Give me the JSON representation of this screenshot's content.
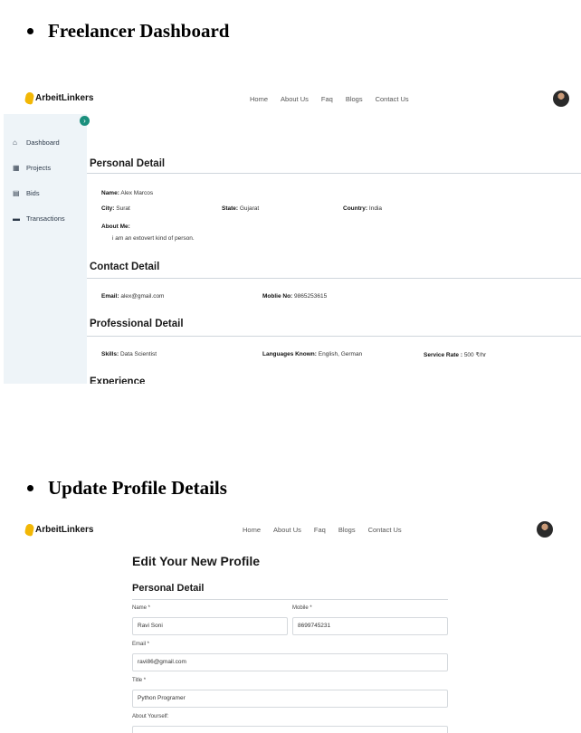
{
  "sections": [
    {
      "heading": "Freelancer Dashboard"
    },
    {
      "heading": "Update Profile Details"
    }
  ],
  "brand": {
    "name": "ArbeitLinkers",
    "accent": "#f2b705"
  },
  "nav": [
    "Home",
    "About Us",
    "Faq",
    "Blogs",
    "Contact Us"
  ],
  "sidebar": {
    "toggle": "›",
    "items": [
      {
        "label": "Dashboard",
        "icon": "home-icon"
      },
      {
        "label": "Projects",
        "icon": "briefcase-icon"
      },
      {
        "label": "Bids",
        "icon": "document-icon"
      },
      {
        "label": "Transactions",
        "icon": "wallet-icon"
      }
    ],
    "bg": "#eef4f8"
  },
  "dashboard": {
    "personal_title": "Personal Detail",
    "name_label": "Name:",
    "name": "Alex Marcos",
    "city_label": "City:",
    "city": "Surat",
    "state_label": "State:",
    "state": "Gujarat",
    "country_label": "Country:",
    "country": "India",
    "about_label": "About Me:",
    "about": "i am an extovert kind of person.",
    "contact_title": "Contact Detail",
    "email_label": "Email:",
    "email": "alex@gmail.com",
    "mobile_label": "Moblie No:",
    "mobile": "9865253615",
    "professional_title": "Professional Detail",
    "skills_label": "Skills:",
    "skills": "Data Scientist",
    "languages_label": "Languages Known:",
    "languages": "English, German",
    "rate_label": "Service Rate :",
    "rate": "500 ₹/hr",
    "experience_title": "Experience"
  },
  "edit": {
    "title": "Edit Your New Profile",
    "personal_title": "Personal Detail",
    "name_label": "Name *",
    "name_value": "Ravi Soni",
    "mobile_label": "Mobile *",
    "mobile_value": "8699745231",
    "email_label": "Email *",
    "email_value": "ravi86@gmail.com",
    "title_label": "Title *",
    "title_value": "Python Programer",
    "about_label": "About Yourself:"
  },
  "colors": {
    "toggle": "#1a8f7d"
  }
}
